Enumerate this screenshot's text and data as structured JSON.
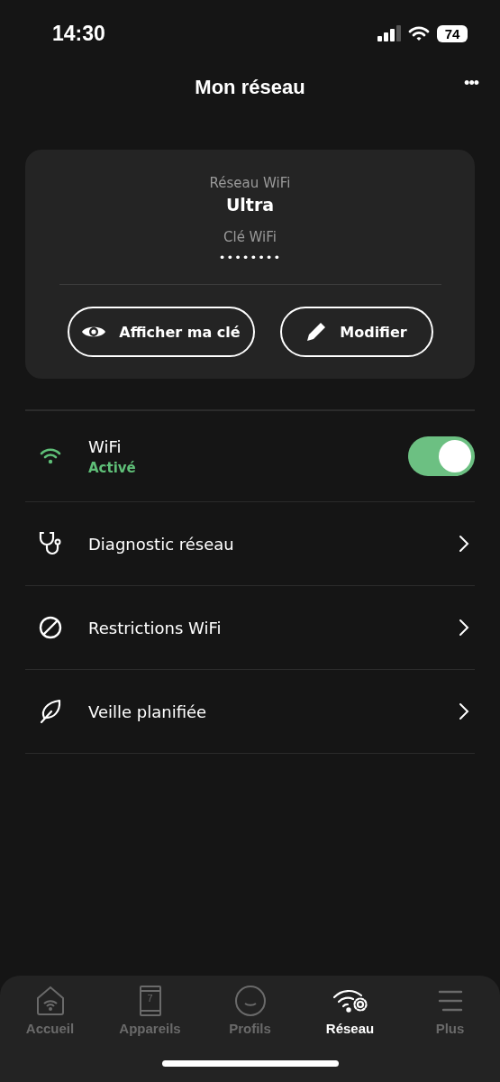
{
  "status_bar": {
    "time": "14:30",
    "battery": "74"
  },
  "header": {
    "title": "Mon réseau",
    "menu": "•••"
  },
  "card": {
    "network_label": "Réseau WiFi",
    "network_name": "Ultra",
    "key_label": "Clé WiFi",
    "key_value": "••••••••",
    "buttons": [
      "Afficher ma clé",
      "Modifier"
    ]
  },
  "settings": [
    {
      "kind": "toggle",
      "label": "WiFi",
      "status": "Activé",
      "on": true
    },
    {
      "kind": "link",
      "label": "Diagnostic réseau"
    },
    {
      "kind": "link",
      "label": "Restrictions WiFi"
    },
    {
      "kind": "link",
      "label": "Veille planifiée"
    }
  ],
  "tab_bar": [
    {
      "label": "Accueil",
      "selected": false
    },
    {
      "label": "Appareils",
      "badge": "7",
      "selected": false
    },
    {
      "label": "Profils",
      "selected": false
    },
    {
      "label": "Réseau",
      "selected": true
    },
    {
      "label": "Plus",
      "selected": false
    }
  ]
}
